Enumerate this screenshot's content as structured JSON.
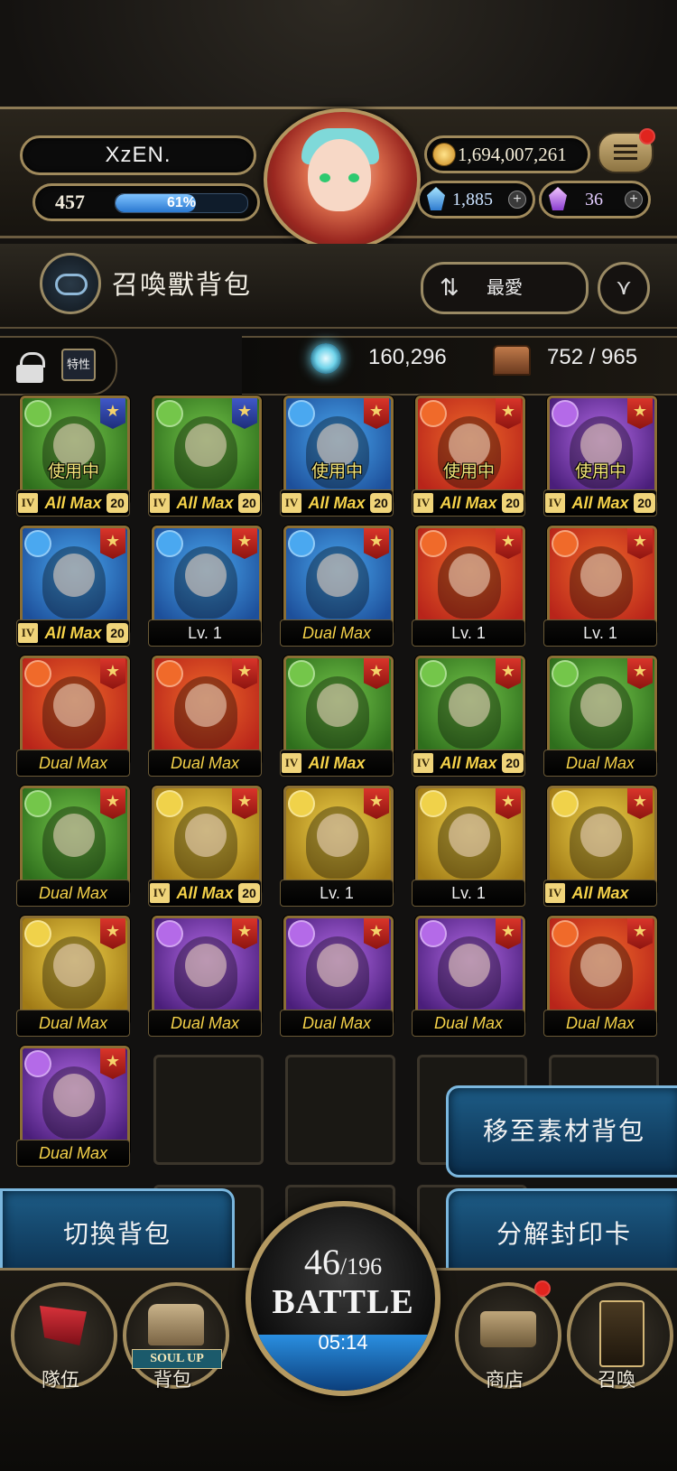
{
  "player": {
    "name": "XzEN.",
    "level": "457",
    "xp_percent": 61,
    "xp_label": "61%"
  },
  "currency": {
    "coins": "1,694,007,261",
    "gems": "1,885",
    "crystals": "36"
  },
  "title_bar": {
    "title": "召喚獸背包",
    "sort_label": "最愛"
  },
  "stats": {
    "trait_label": "特性",
    "souls": "160,296",
    "capacity": "752 / 965"
  },
  "cards": [
    {
      "caption": "All Max",
      "rank": "IV",
      "level": "20",
      "in_use": "使用中",
      "element": "wood",
      "star": "blue"
    },
    {
      "caption": "All Max",
      "rank": "IV",
      "level": "20",
      "in_use": "",
      "element": "wood",
      "star": "blue"
    },
    {
      "caption": "All Max",
      "rank": "IV",
      "level": "20",
      "in_use": "使用中",
      "element": "water",
      "star": "red"
    },
    {
      "caption": "All Max",
      "rank": "IV",
      "level": "20",
      "in_use": "使用中",
      "element": "fire",
      "star": "red"
    },
    {
      "caption": "All Max",
      "rank": "IV",
      "level": "20",
      "in_use": "使用中",
      "element": "dark",
      "star": "red"
    },
    {
      "caption": "All Max",
      "rank": "IV",
      "level": "20",
      "in_use": "",
      "element": "water",
      "star": "red"
    },
    {
      "caption": "Lv. 1",
      "rank": "",
      "level": "",
      "in_use": "",
      "element": "water",
      "star": "red"
    },
    {
      "caption": "Dual Max",
      "rank": "",
      "level": "",
      "in_use": "",
      "element": "water",
      "star": "red"
    },
    {
      "caption": "Lv. 1",
      "rank": "",
      "level": "",
      "in_use": "",
      "element": "fire",
      "star": "red"
    },
    {
      "caption": "Lv. 1",
      "rank": "",
      "level": "",
      "in_use": "",
      "element": "fire",
      "star": "red"
    },
    {
      "caption": "Dual Max",
      "rank": "",
      "level": "",
      "in_use": "",
      "element": "fire",
      "star": "red"
    },
    {
      "caption": "Dual Max",
      "rank": "",
      "level": "",
      "in_use": "",
      "element": "fire",
      "star": "red"
    },
    {
      "caption": "All Max",
      "rank": "IV",
      "level": "",
      "in_use": "",
      "element": "wood",
      "star": "red"
    },
    {
      "caption": "All Max",
      "rank": "IV",
      "level": "20",
      "in_use": "",
      "element": "wood",
      "star": "red"
    },
    {
      "caption": "Dual Max",
      "rank": "",
      "level": "",
      "in_use": "",
      "element": "wood",
      "star": "red"
    },
    {
      "caption": "Dual Max",
      "rank": "",
      "level": "",
      "in_use": "",
      "element": "wood",
      "star": "red"
    },
    {
      "caption": "All Max",
      "rank": "IV",
      "level": "20",
      "in_use": "",
      "element": "light",
      "star": "red"
    },
    {
      "caption": "Lv. 1",
      "rank": "",
      "level": "",
      "in_use": "",
      "element": "light",
      "star": "red"
    },
    {
      "caption": "Lv. 1",
      "rank": "",
      "level": "",
      "in_use": "",
      "element": "light",
      "star": "red"
    },
    {
      "caption": "All Max",
      "rank": "IV",
      "level": "",
      "in_use": "",
      "element": "light",
      "star": "red"
    },
    {
      "caption": "Dual Max",
      "rank": "",
      "level": "",
      "in_use": "",
      "element": "light",
      "star": "red"
    },
    {
      "caption": "Dual Max",
      "rank": "",
      "level": "",
      "in_use": "",
      "element": "dark",
      "star": "red"
    },
    {
      "caption": "Dual Max",
      "rank": "",
      "level": "",
      "in_use": "",
      "element": "dark",
      "star": "red"
    },
    {
      "caption": "Dual Max",
      "rank": "",
      "level": "",
      "in_use": "",
      "element": "dark",
      "star": "red"
    },
    {
      "caption": "Dual Max",
      "rank": "",
      "level": "",
      "in_use": "",
      "element": "fire",
      "star": "red"
    },
    {
      "caption": "Dual Max",
      "rank": "",
      "level": "",
      "in_use": "",
      "element": "dark",
      "star": "red"
    }
  ],
  "actions": {
    "move_to_material": "移至素材背包",
    "switch_bag": "切換背包",
    "decompose": "分解封印卡"
  },
  "battle": {
    "current": "46",
    "max": "/196",
    "label": "BATTLE",
    "timer": "05:14"
  },
  "nav": {
    "team": "隊伍",
    "bag": "背包",
    "bag_badge": "SOUL UP",
    "shop": "商店",
    "summon": "召喚"
  },
  "colors": {
    "fire": "#e04a1e",
    "water": "#2f7bd6",
    "wood": "#4fae2d",
    "light": "#d8b42a",
    "dark": "#8b3fc8",
    "accent_gold": "#a08a5c",
    "action_blue": "#1d5c86"
  }
}
